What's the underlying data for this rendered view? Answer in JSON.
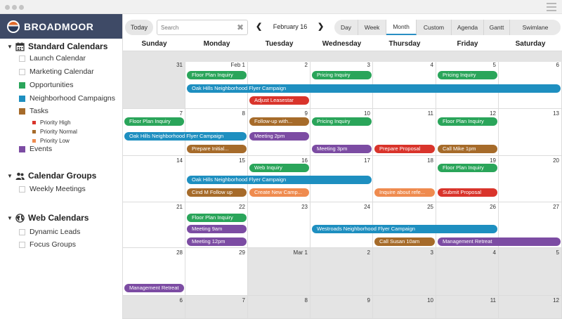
{
  "brand": {
    "name": "BROADMOOR"
  },
  "sidebar": {
    "groups": [
      {
        "title": "Standard Calendars",
        "icon": "calendar-icon"
      },
      {
        "title": "Calendar Groups",
        "icon": "users-icon"
      },
      {
        "title": "Web Calendars",
        "icon": "globe-icon"
      }
    ],
    "standard": [
      {
        "label": "Launch Calendar",
        "color": ""
      },
      {
        "label": "Marketing Calendar",
        "color": ""
      },
      {
        "label": "Opportunities",
        "color": "#2aa55a"
      },
      {
        "label": "Neighborhood Campaigns",
        "color": "#1e8fc0"
      },
      {
        "label": "Tasks",
        "color": "#a66b2a"
      },
      {
        "label": "Events",
        "color": "#7c4ca3"
      }
    ],
    "tasks_sub": [
      {
        "label": "Priority High",
        "color": "#d9342b"
      },
      {
        "label": "Priority Normal",
        "color": "#a66b2a"
      },
      {
        "label": "Priority Low",
        "color": "#ef8b4f"
      }
    ],
    "calendar_groups": [
      {
        "label": "Weekly Meetings"
      }
    ],
    "web_calendars": [
      {
        "label": "Dynamic Leads"
      },
      {
        "label": "Focus Groups"
      }
    ]
  },
  "toolbar": {
    "today": "Today",
    "search_placeholder": "Search",
    "clear": "✖",
    "prev": "❮",
    "next": "❯",
    "date_label": "February 16",
    "views": [
      "Day",
      "Week",
      "Month",
      "Custom",
      "Agenda",
      "Gantt",
      "Swimlane"
    ],
    "active_view": "Month"
  },
  "calendar": {
    "day_names": [
      "Sunday",
      "Monday",
      "Tuesday",
      "Wednesday",
      "Thursday",
      "Friday",
      "Saturday"
    ],
    "weeks": [
      {
        "days": [
          "31",
          "Feb 1",
          "2",
          "3",
          "4",
          "5",
          "6"
        ],
        "gray": [
          true,
          false,
          false,
          false,
          false,
          false,
          false
        ]
      },
      {
        "days": [
          "7",
          "8",
          "9",
          "10",
          "11",
          "12",
          "13"
        ],
        "gray": [
          false,
          false,
          false,
          false,
          false,
          false,
          false
        ]
      },
      {
        "days": [
          "14",
          "15",
          "16",
          "17",
          "18",
          "19",
          "20"
        ],
        "gray": [
          false,
          false,
          false,
          false,
          false,
          false,
          false
        ]
      },
      {
        "days": [
          "21",
          "22",
          "23",
          "24",
          "25",
          "26",
          "27"
        ],
        "gray": [
          false,
          false,
          false,
          false,
          false,
          false,
          false
        ]
      },
      {
        "days": [
          "28",
          "29",
          "Mar 1",
          "2",
          "3",
          "4",
          "5"
        ],
        "gray": [
          false,
          false,
          true,
          true,
          true,
          true,
          true
        ]
      },
      {
        "days": [
          "6",
          "7",
          "8",
          "9",
          "10",
          "11",
          "12"
        ],
        "gray": [
          true,
          true,
          true,
          true,
          true,
          true,
          true
        ]
      }
    ],
    "events": [
      {
        "title": "Floor Plan Inquiry",
        "week": 0,
        "day": 1,
        "span": 1,
        "lane": 0,
        "color": "#2aa55a"
      },
      {
        "title": "Pricing Inquiry",
        "week": 0,
        "day": 3,
        "span": 1,
        "lane": 0,
        "color": "#2aa55a"
      },
      {
        "title": "Pricing Inquiry",
        "week": 0,
        "day": 5,
        "span": 1,
        "lane": 0,
        "color": "#2aa55a"
      },
      {
        "title": "Oak Hills Neighborhood Flyer Campaign",
        "week": 0,
        "day": 1,
        "span": 6,
        "lane": 1,
        "color": "#1e8fc0"
      },
      {
        "title": "Adjust Leasestar",
        "week": 0,
        "day": 2,
        "span": 1,
        "lane": 2,
        "color": "#d9342b"
      },
      {
        "title": "Floor Plan Inquiry",
        "week": 1,
        "day": 0,
        "span": 1,
        "lane": 0,
        "color": "#2aa55a"
      },
      {
        "title": "Follow-up with...",
        "week": 1,
        "day": 2,
        "span": 1,
        "lane": 0,
        "color": "#a66b2a"
      },
      {
        "title": "Pricing Inquiry",
        "week": 1,
        "day": 3,
        "span": 1,
        "lane": 0,
        "color": "#2aa55a"
      },
      {
        "title": "Floor Plan Inquiry",
        "week": 1,
        "day": 5,
        "span": 1,
        "lane": 0,
        "color": "#2aa55a"
      },
      {
        "title": "Oak Hills Neighborhood Flyer Campaign",
        "week": 1,
        "day": 0,
        "span": 2,
        "lane": 1,
        "color": "#1e8fc0"
      },
      {
        "title": "Meeting 2pm",
        "week": 1,
        "day": 2,
        "span": 1,
        "lane": 1,
        "color": "#7c4ca3"
      },
      {
        "title": "Prepare Initial...",
        "week": 1,
        "day": 1,
        "span": 1,
        "lane": 2,
        "color": "#a66b2a"
      },
      {
        "title": "Meeting 3pm",
        "week": 1,
        "day": 3,
        "span": 1,
        "lane": 2,
        "color": "#7c4ca3"
      },
      {
        "title": "Prepare Proposal",
        "week": 1,
        "day": 4,
        "span": 1,
        "lane": 2,
        "color": "#d9342b"
      },
      {
        "title": "Call Mike 1pm",
        "week": 1,
        "day": 5,
        "span": 1,
        "lane": 2,
        "color": "#a66b2a"
      },
      {
        "title": "Web Inquiry",
        "week": 2,
        "day": 2,
        "span": 1,
        "lane": 0,
        "color": "#2aa55a"
      },
      {
        "title": "Floor Plan Inquiry",
        "week": 2,
        "day": 5,
        "span": 1,
        "lane": 0,
        "color": "#2aa55a"
      },
      {
        "title": "Oak Hills Neighborhood Flyer Campaign",
        "week": 2,
        "day": 1,
        "span": 3,
        "lane": 1,
        "color": "#1e8fc0"
      },
      {
        "title": "Cind M Follow up",
        "week": 2,
        "day": 1,
        "span": 1,
        "lane": 2,
        "color": "#a66b2a"
      },
      {
        "title": "Create New Camp...",
        "week": 2,
        "day": 2,
        "span": 1,
        "lane": 2,
        "color": "#ef8b4f"
      },
      {
        "title": "Inquire about refe...",
        "week": 2,
        "day": 4,
        "span": 1,
        "lane": 2,
        "color": "#ef8b4f"
      },
      {
        "title": "Submit Proposal",
        "week": 2,
        "day": 5,
        "span": 1,
        "lane": 2,
        "color": "#d9342b"
      },
      {
        "title": "Floor Plan Inquiry",
        "week": 3,
        "day": 1,
        "span": 1,
        "lane": 0,
        "color": "#2aa55a"
      },
      {
        "title": "Meeting 9am",
        "week": 3,
        "day": 1,
        "span": 1,
        "lane": 1,
        "color": "#7c4ca3"
      },
      {
        "title": "Westroads Neighborhood Flyer Campaign",
        "week": 3,
        "day": 3,
        "span": 3,
        "lane": 1,
        "color": "#1e8fc0"
      },
      {
        "title": "Meeting 12pm",
        "week": 3,
        "day": 1,
        "span": 1,
        "lane": 2,
        "color": "#7c4ca3"
      },
      {
        "title": "Call Susan 10am",
        "week": 3,
        "day": 4,
        "span": 1,
        "lane": 2,
        "color": "#a66b2a"
      },
      {
        "title": "Management Retreat",
        "week": 3,
        "day": 5,
        "span": 2,
        "lane": 2,
        "color": "#7c4ca3"
      },
      {
        "title": "Management Retreat",
        "week": 4,
        "day": 0,
        "span": 1,
        "lane": 3,
        "color": "#7c4ca3"
      }
    ]
  }
}
